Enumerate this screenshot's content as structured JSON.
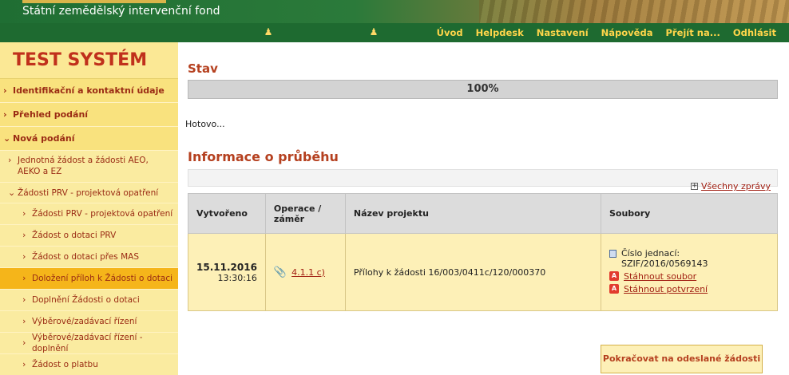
{
  "header": {
    "subtitle": "Státní zemědělský intervenční fond"
  },
  "navbar": {
    "items": [
      "Úvod",
      "Helpdesk",
      "Nastavení",
      "Nápověda",
      "Přejít na...",
      "Odhlásit"
    ]
  },
  "sidebar": {
    "title": "TEST SYSTÉM",
    "items": [
      {
        "label": "Identifikační a kontaktní údaje"
      },
      {
        "label": "Přehled podání"
      },
      {
        "label": "Nová podání"
      },
      {
        "label": "Jednotná žádost a žádosti AEO, AEKO a EZ"
      },
      {
        "label": "Žádosti PRV - projektová opatření"
      },
      {
        "label": "Žádosti PRV - projektová opatření"
      },
      {
        "label": "Žádost o dotaci PRV"
      },
      {
        "label": "Žádost o dotaci přes MAS"
      },
      {
        "label": "Doložení příloh k Žádosti o dotaci"
      },
      {
        "label": "Doplnění Žádosti o dotaci"
      },
      {
        "label": "Výběrové/zadávací řízení"
      },
      {
        "label": "Výběrové/zadávací řízení - doplnění"
      },
      {
        "label": "Žádost o platbu"
      }
    ]
  },
  "main": {
    "stav_title": "Stav",
    "progress_text": "100%",
    "progress_value": 100,
    "status_text": "Hotovo...",
    "info_title": "Informace o průběhu",
    "all_messages": "Všechny zprávy",
    "table": {
      "headers": [
        "Vytvořeno",
        "Operace / záměr",
        "Název projektu",
        "Soubory"
      ],
      "rows": [
        {
          "date": "15.11.2016",
          "time": "13:30:16",
          "operation": "4.1.1 c)",
          "project": "Přílohy k žádosti 16/003/0411c/120/000370",
          "ref_label": "Číslo jednací:",
          "ref_value": "SZIF/2016/0569143",
          "download_file": "Stáhnout soubor",
          "download_confirm": "Stáhnout potvrzení"
        }
      ]
    },
    "continue_button": "Pokračovat na odeslané žádosti"
  },
  "colors": {
    "nav_bg": "#1e6a30",
    "nav_text": "#ffd54a",
    "sidebar_bg": "#f9e58a",
    "active_item": "#f5b51a",
    "accent_red": "#b5401f"
  }
}
